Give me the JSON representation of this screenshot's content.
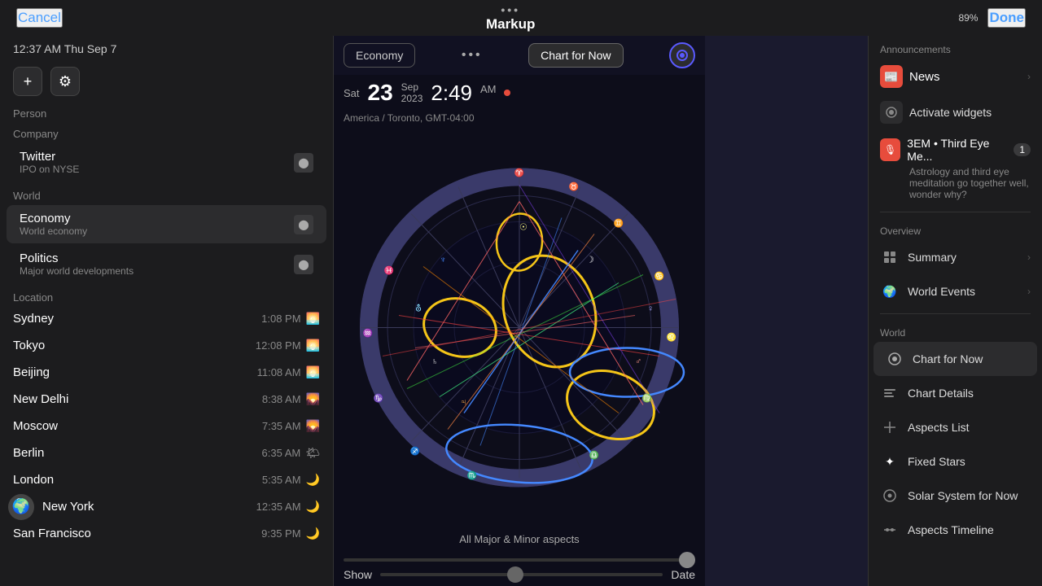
{
  "topBar": {
    "cancel": "Cancel",
    "dots": "•••",
    "title": "Markup",
    "done": "Done",
    "time": "12:37 AM",
    "date": "Thu Sep 7",
    "battery": "89%"
  },
  "leftSidebar": {
    "time": "12:37 AM  Thu Sep 7",
    "personLabel": "Person",
    "companyLabel": "Company",
    "company": {
      "name": "Twitter",
      "sub": "IPO on NYSE"
    },
    "worldLabel": "World",
    "worldItems": [
      {
        "name": "Economy",
        "sub": "World economy",
        "active": true
      },
      {
        "name": "Politics",
        "sub": "Major world developments",
        "active": false
      }
    ],
    "locationLabel": "Location",
    "locations": [
      {
        "name": "Sydney",
        "time": "1:08 PM",
        "icon": "🌅"
      },
      {
        "name": "Tokyo",
        "time": "12:08 PM",
        "icon": "🌅"
      },
      {
        "name": "Beijing",
        "time": "11:08 AM",
        "icon": "🌅"
      },
      {
        "name": "New Delhi",
        "time": "8:38 AM",
        "icon": "🌄"
      },
      {
        "name": "Moscow",
        "time": "7:35 AM",
        "icon": "🌄"
      },
      {
        "name": "Berlin",
        "time": "6:35 AM",
        "icon": "🌤"
      },
      {
        "name": "London",
        "time": "5:35 AM",
        "icon": "🌙"
      },
      {
        "name": "New York",
        "time": "12:35 AM",
        "icon": "🌙"
      },
      {
        "name": "San Francisco",
        "time": "9:35 PM",
        "icon": "🌙"
      }
    ]
  },
  "center": {
    "dots": "•••",
    "economyBtn": "Economy",
    "chartForNowBtn": "Chart for Now",
    "dayLabel": "Sat",
    "dateNum": "23",
    "month": "Sep",
    "year": "2023",
    "time": "2:49",
    "ampm": "AM",
    "location": "America / Toronto, GMT-04:00",
    "chartLabel": "All Major & Minor aspects",
    "showLabel": "Show",
    "dateLabel": "Date"
  },
  "rightSidebar": {
    "announcementsLabel": "Announcements",
    "newsLabel": "News",
    "activateWidgets": "Activate widgets",
    "podcast": {
      "title": "3EM • Third Eye Me...",
      "desc": "Astrology and third eye meditation go together well, wonder why?",
      "badge": "1"
    },
    "overviewLabel": "Overview",
    "overviewItems": [
      {
        "label": "Summary",
        "active": false
      },
      {
        "label": "World Events",
        "active": false
      }
    ],
    "worldLabel": "World",
    "worldItems": [
      {
        "label": "Chart for Now",
        "active": true
      },
      {
        "label": "Chart Details",
        "active": false
      },
      {
        "label": "Aspects List",
        "active": false
      },
      {
        "label": "Fixed Stars",
        "active": false
      },
      {
        "label": "Solar System for Now",
        "active": false
      },
      {
        "label": "Aspects Timeline",
        "active": false
      }
    ]
  }
}
